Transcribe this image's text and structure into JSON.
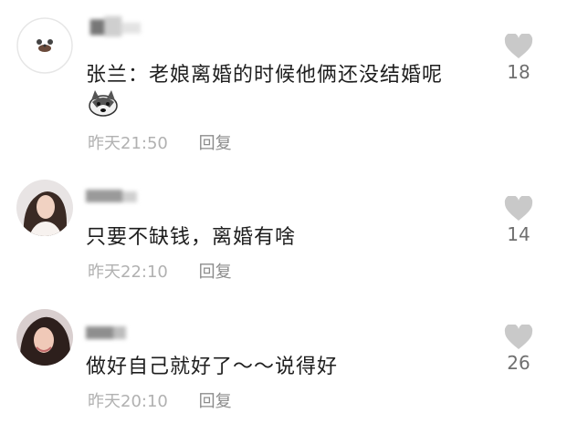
{
  "comments": [
    {
      "text": "张兰：老娘离婚的时候他俩还没结婚呢",
      "emoji": "husky-doge-emoji",
      "time": "昨天21:50",
      "reply_label": "回复",
      "likes": "18",
      "avatar": "cartoon-bear-avatar"
    },
    {
      "text": "只要不缺钱，离婚有啥",
      "time": "昨天22:10",
      "reply_label": "回复",
      "likes": "14",
      "avatar": "woman-photo-avatar"
    },
    {
      "text": "做好自己就好了～～说得好",
      "time": "昨天20:10",
      "reply_label": "回复",
      "likes": "26",
      "avatar": "woman-photo-avatar"
    }
  ],
  "colors": {
    "text": "#1e1e1e",
    "meta": "#b1b1b1",
    "reply": "#8c8c8c",
    "like_icon": "#c9c9c9",
    "like_count": "#6f6f6f"
  }
}
